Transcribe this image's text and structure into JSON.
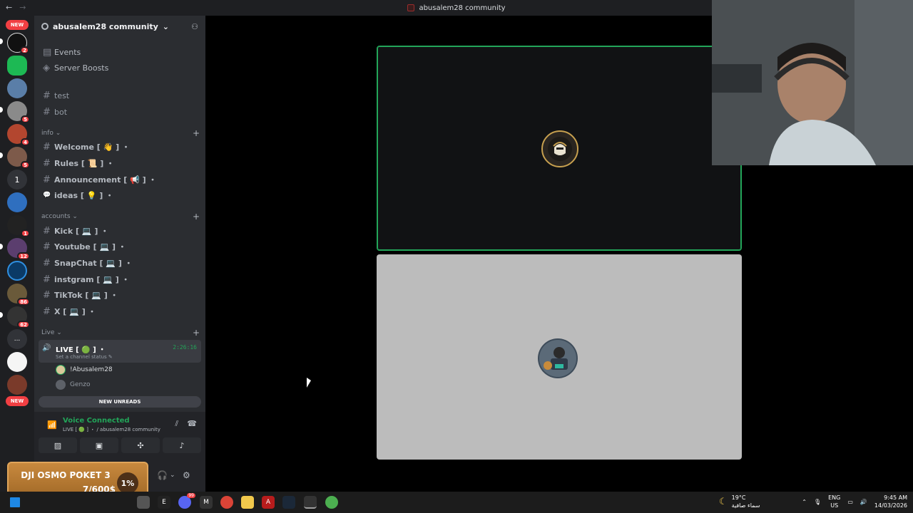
{
  "window": {
    "title": "abusalem28 community",
    "back": "←",
    "forward": "→"
  },
  "server_rail": {
    "new_top": "NEW",
    "new_bottom": "NEW",
    "badges": [
      "2",
      "5",
      "4",
      "5",
      "1",
      "12",
      "86",
      "62"
    ],
    "text_server": "1",
    "more": "..."
  },
  "guild": {
    "name": "abusalem28 community",
    "chevron": "⌄"
  },
  "channels_top": [
    {
      "icon": "calendar-icon",
      "label": "Events"
    },
    {
      "icon": "boost-icon",
      "label": "Server Boosts"
    }
  ],
  "channels_plain": [
    {
      "hash": "#",
      "label": "test"
    },
    {
      "hash": "#",
      "label": "bot"
    }
  ],
  "categories": {
    "info": "info",
    "accounts": "accounts",
    "live": "Live"
  },
  "info_channels": [
    {
      "hash": "#",
      "label": "Welcome [ 👋 ] ・"
    },
    {
      "hash": "#",
      "label": "Rules [ 📜 ] ・"
    },
    {
      "hash": "#",
      "label": "Announcement [ 📢 ] ・"
    },
    {
      "hash": "💬",
      "label": "ideas [ 💡 ] ・"
    }
  ],
  "account_channels": [
    {
      "hash": "#",
      "label": "Kick [ 💻 ] ・"
    },
    {
      "hash": "#",
      "label": "Youtube [ 💻 ] ・"
    },
    {
      "hash": "#",
      "label": "SnapChat [ 💻 ] ・"
    },
    {
      "hash": "#",
      "label": "instgram [ 💻 ] ・"
    },
    {
      "hash": "#",
      "label": "TikTok [ 💻 ] ・"
    },
    {
      "hash": "#",
      "label": "X [ 💻 ] ・"
    }
  ],
  "voice_channel": {
    "name": "LIVE [ 🟢 ] ・",
    "status": "Set a channel status ✎",
    "timer": "2:26:16",
    "users": [
      "!Abusalem28",
      "Genzo"
    ]
  },
  "new_unreads": "NEW UNREADS",
  "voice_panel": {
    "title": "Voice Connected",
    "subtitle": "LIVE [ 🟢 ] ・ / abusalem28 community"
  },
  "goal": {
    "title": "DJI OSMO POKET 3",
    "value": "7/600$",
    "percent": "1%",
    "progress_fraction": 0.01
  },
  "taskbar": {
    "weather_temp": "19°C",
    "weather_desc": "سماء صافية",
    "lang_top": "ENG",
    "lang_bottom": "US",
    "time": "9:45 AM",
    "date": "14/03/2026",
    "steam_badge": "99"
  },
  "colors": {
    "accent_green": "#23a559",
    "danger_red": "#f23f43",
    "sidebar_bg": "#2b2d31"
  }
}
